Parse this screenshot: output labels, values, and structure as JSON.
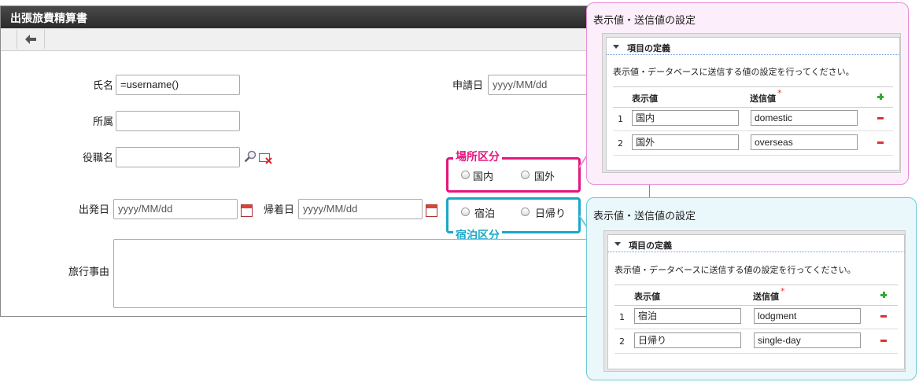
{
  "form": {
    "title": "出張旅費精算書",
    "fields": {
      "name_label": "氏名",
      "name_value": "=username()",
      "apply_date_label": "申請日",
      "apply_date_placeholder": "yyyy/MM/dd",
      "department_label": "所属",
      "position_label": "役職名",
      "depart_label": "出発日",
      "depart_placeholder": "yyyy/MM/dd",
      "return_label": "帰着日",
      "return_placeholder": "yyyy/MM/dd",
      "reason_label": "旅行事由"
    },
    "place_group": {
      "label": "場所区分",
      "color": "#e4157f",
      "options": [
        "国内",
        "国外"
      ]
    },
    "lodging_group": {
      "label": "宿泊区分",
      "color": "#18a8c8",
      "options": [
        "宿泊",
        "日帰り"
      ]
    }
  },
  "panels": [
    {
      "title": "表示値・送信値の設定",
      "section_title": "項目の定義",
      "description": "表示値・データベースに送信する値の設定を行ってください。",
      "col_display": "表示値",
      "col_send": "送信値",
      "required_mark": "*",
      "rows": [
        {
          "index": "1",
          "display": "国内",
          "send": "domestic"
        },
        {
          "index": "2",
          "display": "国外",
          "send": "overseas"
        }
      ]
    },
    {
      "title": "表示値・送信値の設定",
      "section_title": "項目の定義",
      "description": "表示値・データベースに送信する値の設定を行ってください。",
      "col_display": "表示値",
      "col_send": "送信値",
      "required_mark": "*",
      "rows": [
        {
          "index": "1",
          "display": "宿泊",
          "send": "lodgment"
        },
        {
          "index": "2",
          "display": "日帰り",
          "send": "single-day"
        }
      ]
    }
  ],
  "colors": {
    "pink_border": "#e88bd8",
    "pink_fill": "#fdeefb",
    "cyan_border": "#6cc8d6",
    "cyan_fill": "#eaf8fb"
  }
}
